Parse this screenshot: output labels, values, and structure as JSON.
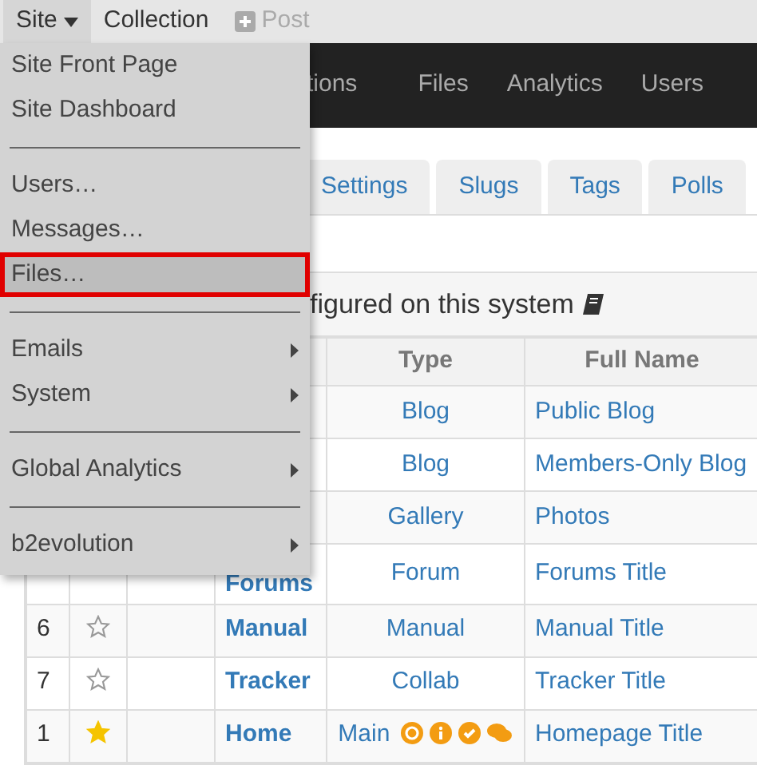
{
  "topbar": {
    "items": [
      {
        "label": "Site",
        "kind": "dropdown",
        "expanded": true,
        "disabled": false
      },
      {
        "label": "Collection",
        "kind": "link",
        "expanded": false,
        "disabled": false
      },
      {
        "label": "Post",
        "kind": "add",
        "expanded": false,
        "disabled": true
      }
    ]
  },
  "site_menu": {
    "items": [
      {
        "kind": "item",
        "label": "Site Front Page",
        "highlighted": false
      },
      {
        "kind": "item",
        "label": "Site Dashboard",
        "highlighted": false
      },
      {
        "kind": "divider"
      },
      {
        "kind": "item",
        "label": "Users…",
        "highlighted": false
      },
      {
        "kind": "item",
        "label": "Messages…",
        "highlighted": false
      },
      {
        "kind": "item",
        "label": "Files…",
        "highlighted": true
      },
      {
        "kind": "divider"
      },
      {
        "kind": "submenu",
        "label": "Emails",
        "highlighted": false
      },
      {
        "kind": "submenu",
        "label": "System",
        "highlighted": false
      },
      {
        "kind": "divider"
      },
      {
        "kind": "submenu",
        "label": "Global Analytics",
        "highlighted": false
      },
      {
        "kind": "divider"
      },
      {
        "kind": "submenu",
        "label": "b2evolution",
        "highlighted": false
      }
    ]
  },
  "main_nav": {
    "items": [
      "tions",
      "Files",
      "Analytics",
      "Users"
    ]
  },
  "tabs": [
    {
      "label": "Settings",
      "selected": false
    },
    {
      "label": "Slugs",
      "selected": false
    },
    {
      "label": "Tags",
      "selected": false
    },
    {
      "label": "Polls",
      "selected": false
    }
  ],
  "panel": {
    "title": "figured on this system"
  },
  "table": {
    "columns": [
      "Type",
      "Full Name"
    ],
    "rows": [
      {
        "type": "Blog",
        "full_name": "Public Blog"
      },
      {
        "type": "Blog",
        "full_name": "Members-Only Blog"
      },
      {
        "type": "Gallery",
        "full_name": "Photos"
      },
      {
        "name": "Forums",
        "type": "Forum",
        "full_name": "Forums Title"
      },
      {
        "number": "6",
        "starred": false,
        "name": "Manual",
        "type": "Manual",
        "full_name": "Manual Title"
      },
      {
        "number": "7",
        "starred": false,
        "name": "Tracker",
        "type": "Collab",
        "full_name": "Tracker Title"
      },
      {
        "number": "1",
        "starred": true,
        "name": "Home",
        "type": "Main",
        "status_icons": true,
        "full_name": "Homepage Title"
      }
    ]
  }
}
